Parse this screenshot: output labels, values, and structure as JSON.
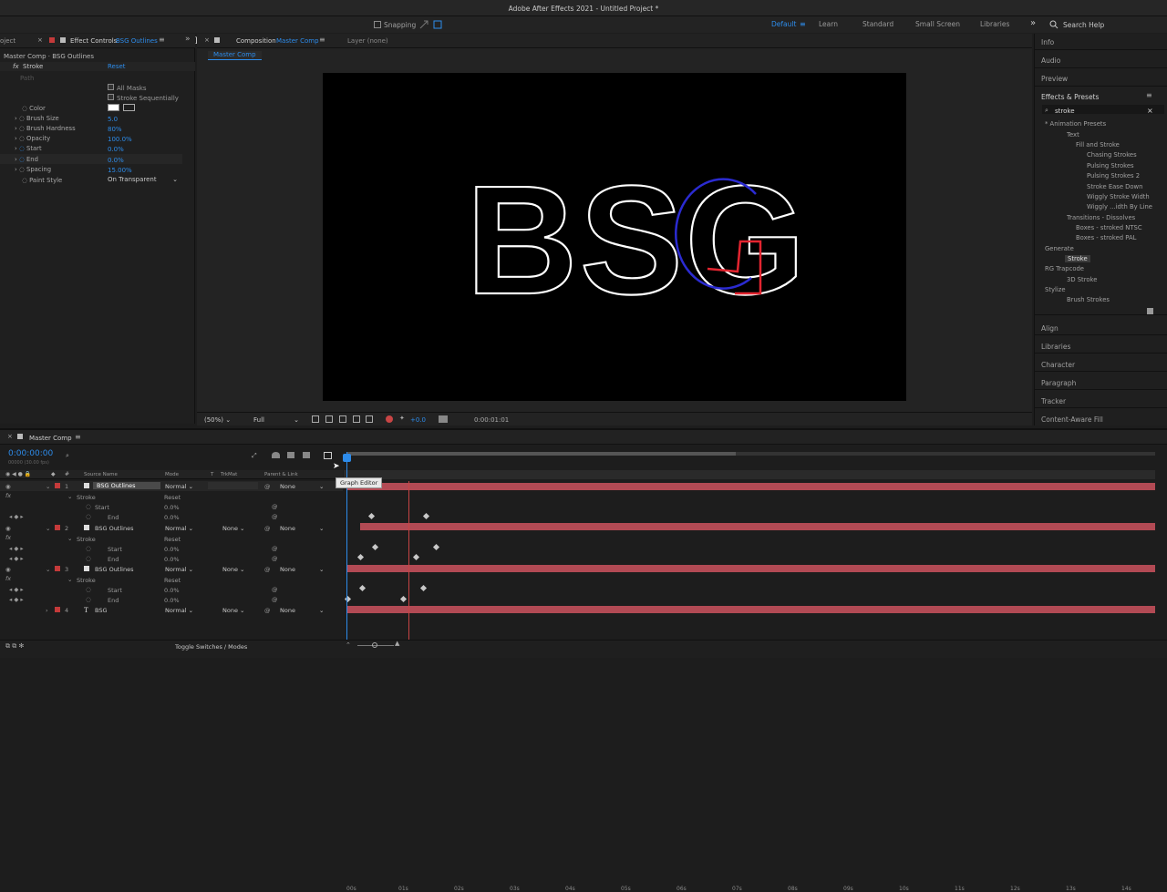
{
  "app_title": "Adobe After Effects 2021 - Untitled Project *",
  "toolbar": {
    "snapping": "Snapping",
    "workspaces": [
      "Default",
      "Learn",
      "Standard",
      "Small Screen",
      "Libraries"
    ],
    "search_help": "Search Help"
  },
  "effect_controls": {
    "panel_left_stub": "oject",
    "tab_label": "Effect Controls",
    "tab_layer": "BSG Outlines",
    "breadcrumb": "Master Comp · BSG Outlines",
    "effect_name": "Stroke",
    "reset": "Reset",
    "path_label": "Path",
    "all_masks": "All Masks",
    "stroke_seq": "Stroke Sequentially",
    "props": [
      {
        "name": "Color",
        "value": ""
      },
      {
        "name": "Brush Size",
        "value": "5.0"
      },
      {
        "name": "Brush Hardness",
        "value": "80%"
      },
      {
        "name": "Opacity",
        "value": "100.0%"
      },
      {
        "name": "Start",
        "value": "0.0%"
      },
      {
        "name": "End",
        "value": "0.0%"
      },
      {
        "name": "Spacing",
        "value": "15.00%"
      },
      {
        "name": "Paint Style",
        "value": "On Transparent"
      }
    ]
  },
  "composition": {
    "tab_label": "Composition",
    "tab_comp": "Master Comp",
    "layer_tab": "Layer (none)",
    "sub_tab": "Master Comp",
    "canvas_text": [
      "BSG"
    ],
    "zoom": "(50%)",
    "resolution": "Full",
    "exposure": "+0.0",
    "timecode": "0:00:01:01"
  },
  "right_panel": {
    "info": "Info",
    "audio": "Audio",
    "preview": "Preview",
    "effects_presets": "Effects & Presets",
    "search_value": "stroke",
    "tree": [
      "* Animation Presets",
      "Text",
      "Fill and Stroke",
      "Chasing Strokes",
      "Pulsing Strokes",
      "Pulsing Strokes 2",
      "Stroke Ease Down",
      "Wiggly Stroke Width",
      "Wiggly ...idth By Line",
      "Transitions - Dissolves",
      "Boxes - stroked NTSC",
      "Boxes - stroked PAL",
      "Generate",
      "Stroke",
      "RG Trapcode",
      "3D Stroke",
      "Stylize",
      "Brush Strokes"
    ],
    "bottom": [
      "Align",
      "Libraries",
      "Character",
      "Paragraph",
      "Tracker",
      "Content-Aware Fill"
    ]
  },
  "timeline": {
    "tab": "Master Comp",
    "timecode": "0:00:00:00",
    "fps": "00000 (30.00 fps)",
    "headers": {
      "source": "Source Name",
      "mode": "Mode",
      "t": "T",
      "trkmat": "TrkMat",
      "parent": "Parent & Link"
    },
    "ruler": [
      "00s",
      "01s",
      "02s",
      "03s",
      "04s",
      "05s",
      "06s",
      "07s",
      "08s",
      "09s",
      "10s",
      "11s",
      "12s",
      "13s",
      "14s"
    ],
    "tooltip": "Graph Editor",
    "layers": [
      {
        "num": "1",
        "name": "BSG Outlines",
        "mode": "Normal",
        "trkmat": "",
        "parent": "None",
        "group": "Stroke",
        "reset": "Reset",
        "start": "0.0%",
        "end": "0.0%",
        "start_label": "Start",
        "end_label": "End"
      },
      {
        "num": "2",
        "name": "BSG Outlines",
        "mode": "Normal",
        "trkmat": "None",
        "parent": "None",
        "group": "Stroke",
        "reset": "Reset",
        "start": "0.0%",
        "end": "0.0%",
        "start_label": "Start",
        "end_label": "End"
      },
      {
        "num": "3",
        "name": "BSG Outlines",
        "mode": "Normal",
        "trkmat": "None",
        "parent": "None",
        "group": "Stroke",
        "reset": "Reset",
        "start": "0.0%",
        "end": "0.0%",
        "start_label": "Start",
        "end_label": "End"
      },
      {
        "num": "4",
        "name": "BSG",
        "mode": "Normal",
        "trkmat": "None",
        "parent": "None"
      }
    ],
    "toggle": "Toggle Switches / Modes"
  },
  "colors": {
    "accent": "#2d8ceb",
    "bar": "#b24a54",
    "blue_stroke": "#2b2bd1",
    "red_stroke": "#e32530"
  }
}
